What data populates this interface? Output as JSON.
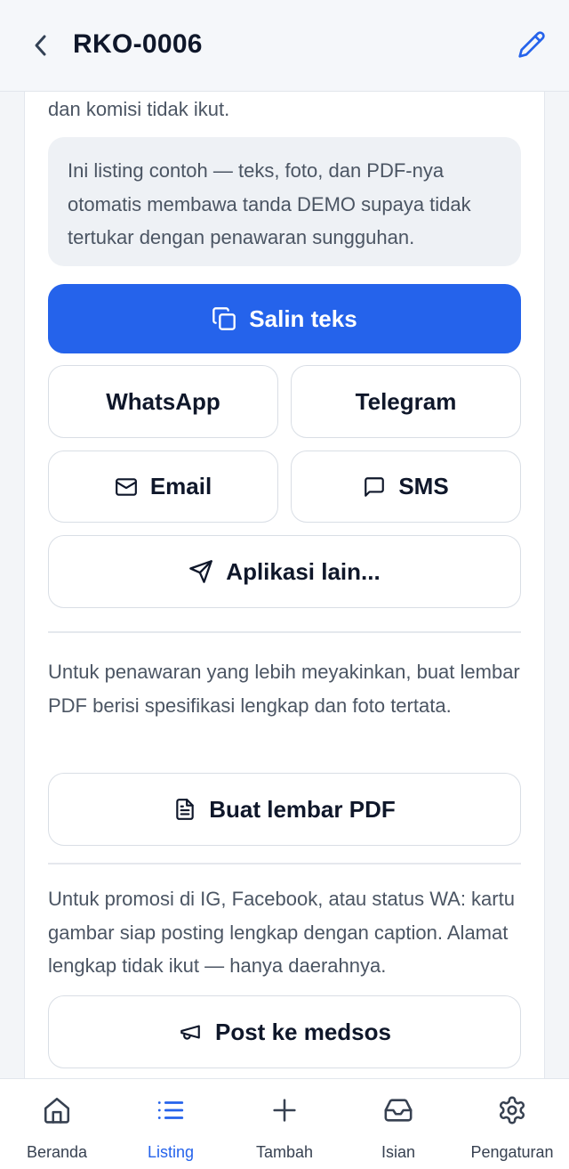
{
  "header": {
    "title": "RKO-0006",
    "back_icon": "chevron-left-icon",
    "edit_icon": "pencil-icon"
  },
  "share": {
    "intro_text": "dan komisi tidak ikut.",
    "demo_notice": "Ini listing contoh — teks, foto, dan PDF-nya otomatis membawa tanda DEMO supaya tidak tertukar dengan penawaran sungguhan.",
    "copy_button": "Salin teks",
    "whatsapp_button": "WhatsApp",
    "telegram_button": "Telegram",
    "email_button": "Email",
    "sms_button": "SMS",
    "other_apps_button": "Aplikasi lain..."
  },
  "pdf": {
    "description": "Untuk penawaran yang lebih meyakinkan, buat lembar PDF berisi spesifikasi lengkap dan foto tertata.",
    "button": "Buat lembar PDF"
  },
  "social": {
    "description": "Untuk promosi di IG, Facebook, atau status WA: kartu gambar siap posting lengkap dengan caption. Alamat lengkap tidak ikut — hanya daerahnya.",
    "button": "Post ke medsos"
  },
  "bottom_nav": {
    "items": [
      {
        "label": "Beranda",
        "icon": "home-icon"
      },
      {
        "label": "Listing",
        "icon": "list-icon",
        "active": true
      },
      {
        "label": "Tambah",
        "icon": "plus-icon"
      },
      {
        "label": "Isian",
        "icon": "inbox-icon"
      },
      {
        "label": "Pengaturan",
        "icon": "gear-icon"
      }
    ]
  },
  "colors": {
    "accent": "#2563eb",
    "text": "#0f172a",
    "muted": "#4b5563"
  }
}
